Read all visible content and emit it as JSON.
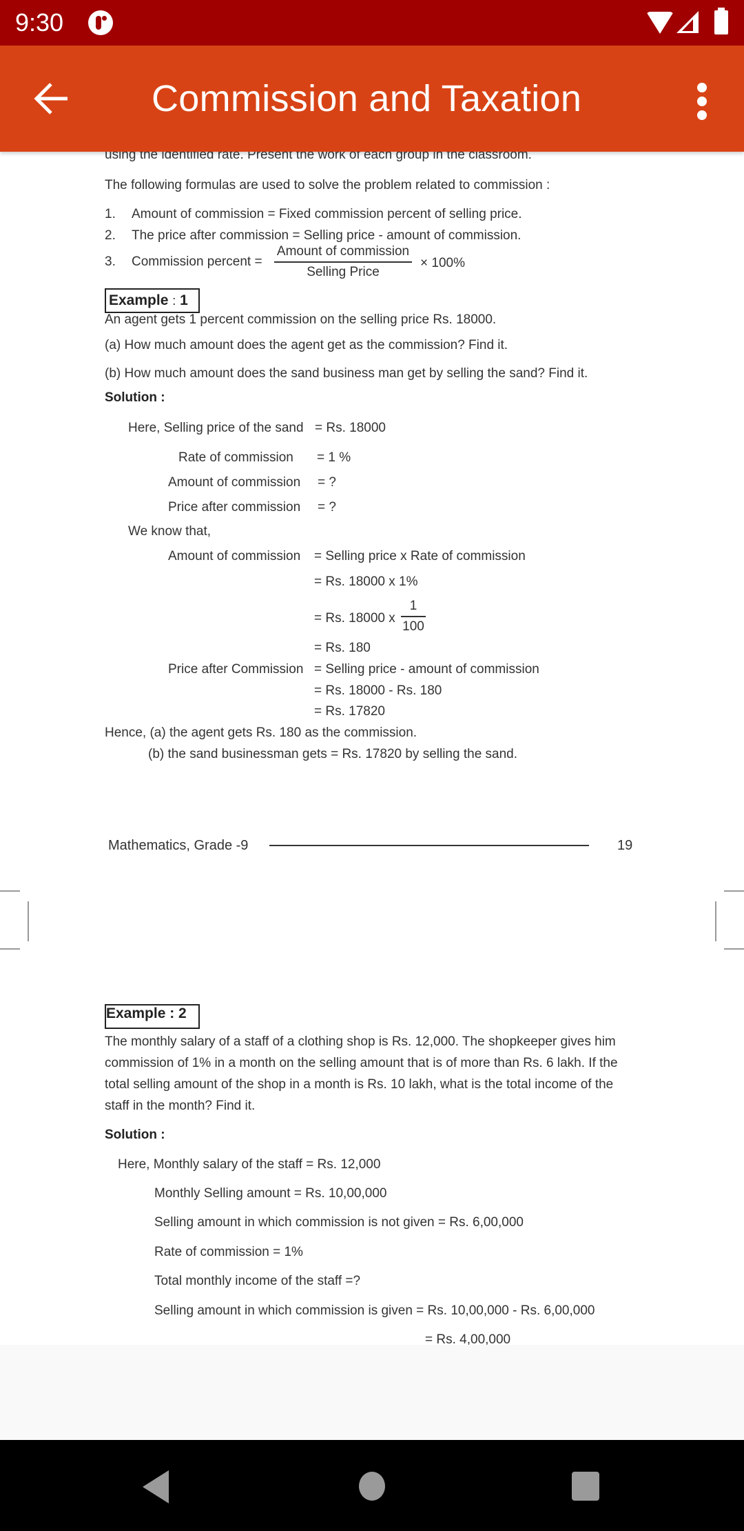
{
  "status_bar": {
    "time": "9:30",
    "icons": [
      "app-notification-icon",
      "wifi-icon",
      "signal-icon",
      "battery-icon"
    ]
  },
  "app_bar": {
    "title": "Commission and Taxation",
    "back_icon": "arrow-left-icon",
    "menu_icon": "more-vert-icon",
    "color": "#d84315",
    "status_color": "#a00000"
  },
  "page1": {
    "intro_tail": "using the identified rate. Present the work of each group in the classroom.",
    "formulas_intro": "The following formulas are used to solve the problem related to commission :",
    "formulas": [
      {
        "num": "1.",
        "text": "Amount of commission = Fixed commission percent of selling price."
      },
      {
        "num": "2.",
        "text": "The price after commission = Selling price - amount of commission."
      },
      {
        "num": "3.",
        "text": "Commission percent =",
        "numerator": "Amount of commission",
        "denominator": "Selling Price",
        "suffix": "× 100%"
      }
    ],
    "example1": {
      "label": "Example",
      "sep": ":",
      "number": "1",
      "question": "An agent gets 1 percent commission on the selling price Rs. 18000.",
      "part_a": "(a) How much amount does the agent get as the commission? Find it.",
      "part_b": "(b) How much amount does the sand business man get by selling the sand? Find it.",
      "solution_label": "Solution :",
      "given": [
        {
          "label": "Here, Selling price of the sand",
          "value": "= Rs. 18000"
        },
        {
          "label": "Rate of commission",
          "value": "= 1 %"
        },
        {
          "label": "Amount of commission",
          "value": "= ?"
        },
        {
          "label": "Price after commission",
          "value": "= ?"
        }
      ],
      "we_know": "We know that,",
      "steps": [
        {
          "label": "Amount of commission",
          "value": "=  Selling price x Rate of commission"
        },
        {
          "label": "",
          "value": "=  Rs. 18000 x 1%"
        },
        {
          "label": "",
          "value": "=  Rs. 18000 x",
          "numerator": "1",
          "denominator": "100"
        },
        {
          "label": "",
          "value": "=  Rs. 180"
        },
        {
          "label": "Price after Commission",
          "value": "=  Selling price - amount of commission"
        },
        {
          "label": "",
          "value": "=   Rs. 18000 - Rs. 180"
        },
        {
          "label": "",
          "value": "=   Rs. 17820"
        }
      ],
      "conclusion_a": "Hence, (a) the agent gets Rs. 180 as the commission.",
      "conclusion_b": "(b) the sand businessman gets = Rs. 17820 by selling the sand."
    },
    "footer": {
      "book": "Mathematics, Grade -9",
      "page": "19"
    }
  },
  "page2": {
    "example2": {
      "label": "Example : 2",
      "question_lines": [
        "The monthly salary of a staff of a clothing shop is Rs. 12,000. The shopkeeper gives him",
        "commission of 1% in a month on the selling amount that is of more than Rs. 6 lakh. If the",
        "total selling amount of the shop in a month is Rs. 10 lakh, what is the total income of the",
        "staff in the month? Find it."
      ],
      "solution_label": "Solution :",
      "lines": [
        "Here, Monthly salary of the staff = Rs. 12,000",
        "Monthly Selling amount = Rs. 10,00,000",
        "Selling amount in which commission is not given = Rs. 6,00,000",
        "Rate of commission = 1%",
        "Total monthly income of the staff =?",
        "Selling amount in which commission is given = Rs. 10,00,000 - Rs. 6,00,000",
        "= Rs. 4,00,000"
      ]
    }
  },
  "nav_bar": {
    "buttons": [
      "back",
      "home",
      "recents"
    ]
  }
}
